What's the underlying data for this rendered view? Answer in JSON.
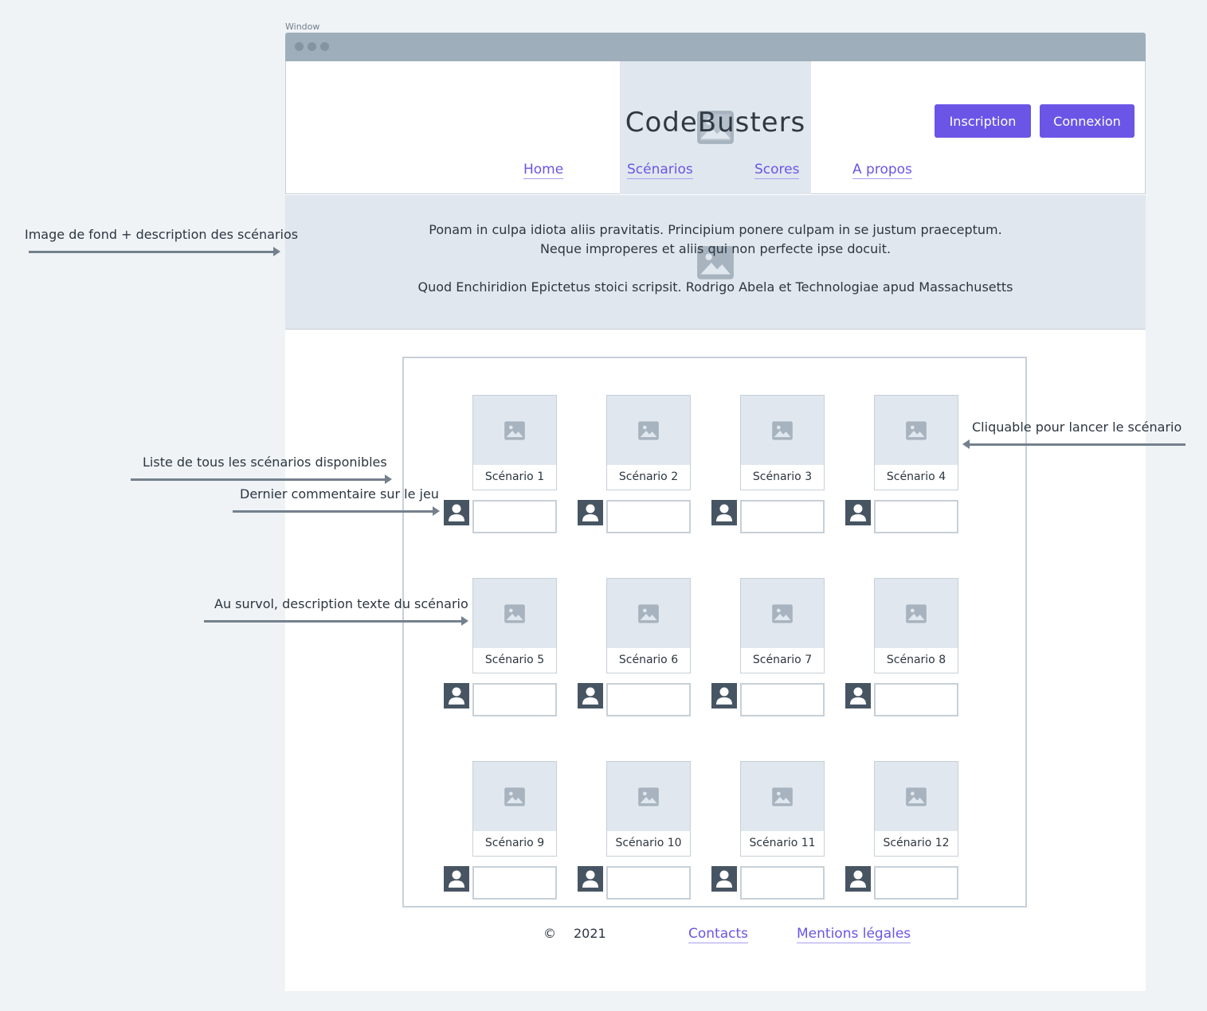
{
  "window": {
    "label": "Window"
  },
  "header": {
    "logo_text": "CodeBusters",
    "nav": [
      {
        "label": "Home"
      },
      {
        "label": "Scénarios"
      },
      {
        "label": "Scores"
      },
      {
        "label": "A propos"
      }
    ],
    "buttons": {
      "signup": "Inscription",
      "login": "Connexion"
    }
  },
  "hero": {
    "line1": "Ponam in culpa idiota aliis pravitatis. Principium ponere culpam in se justum praeceptum.",
    "line2": "Neque improperes et aliis qui non perfecte ipse docuit.",
    "line3": "Quod Enchiridion Epictetus stoici scripsit. Rodrigo Abela et Technologiae apud Massachusetts"
  },
  "scenarios": [
    "Scénario 1",
    "Scénario 2",
    "Scénario 3",
    "Scénario 4",
    "Scénario 5",
    "Scénario 6",
    "Scénario 7",
    "Scénario 8",
    "Scénario 9",
    "Scénario 10",
    "Scénario 11",
    "Scénario 12"
  ],
  "annotations": {
    "hero": "Image de fond + description des scénarios",
    "list": "Liste de tous les scénarios disponibles",
    "comment": "Dernier commentaire sur le jeu",
    "hover": "Au survol, description texte du scénario",
    "click": "Cliquable pour lancer le scénario"
  },
  "footer": {
    "copyright_symbol": "©",
    "year": "2021",
    "contacts": "Contacts",
    "legal": "Mentions légales"
  },
  "colors": {
    "accent": "#6a55e6",
    "placeholder": "#e1e7ee",
    "border": "#c7d0d8",
    "avatar": "#475563"
  },
  "icons": {
    "image_placeholder": "image-icon",
    "user": "user-icon"
  }
}
